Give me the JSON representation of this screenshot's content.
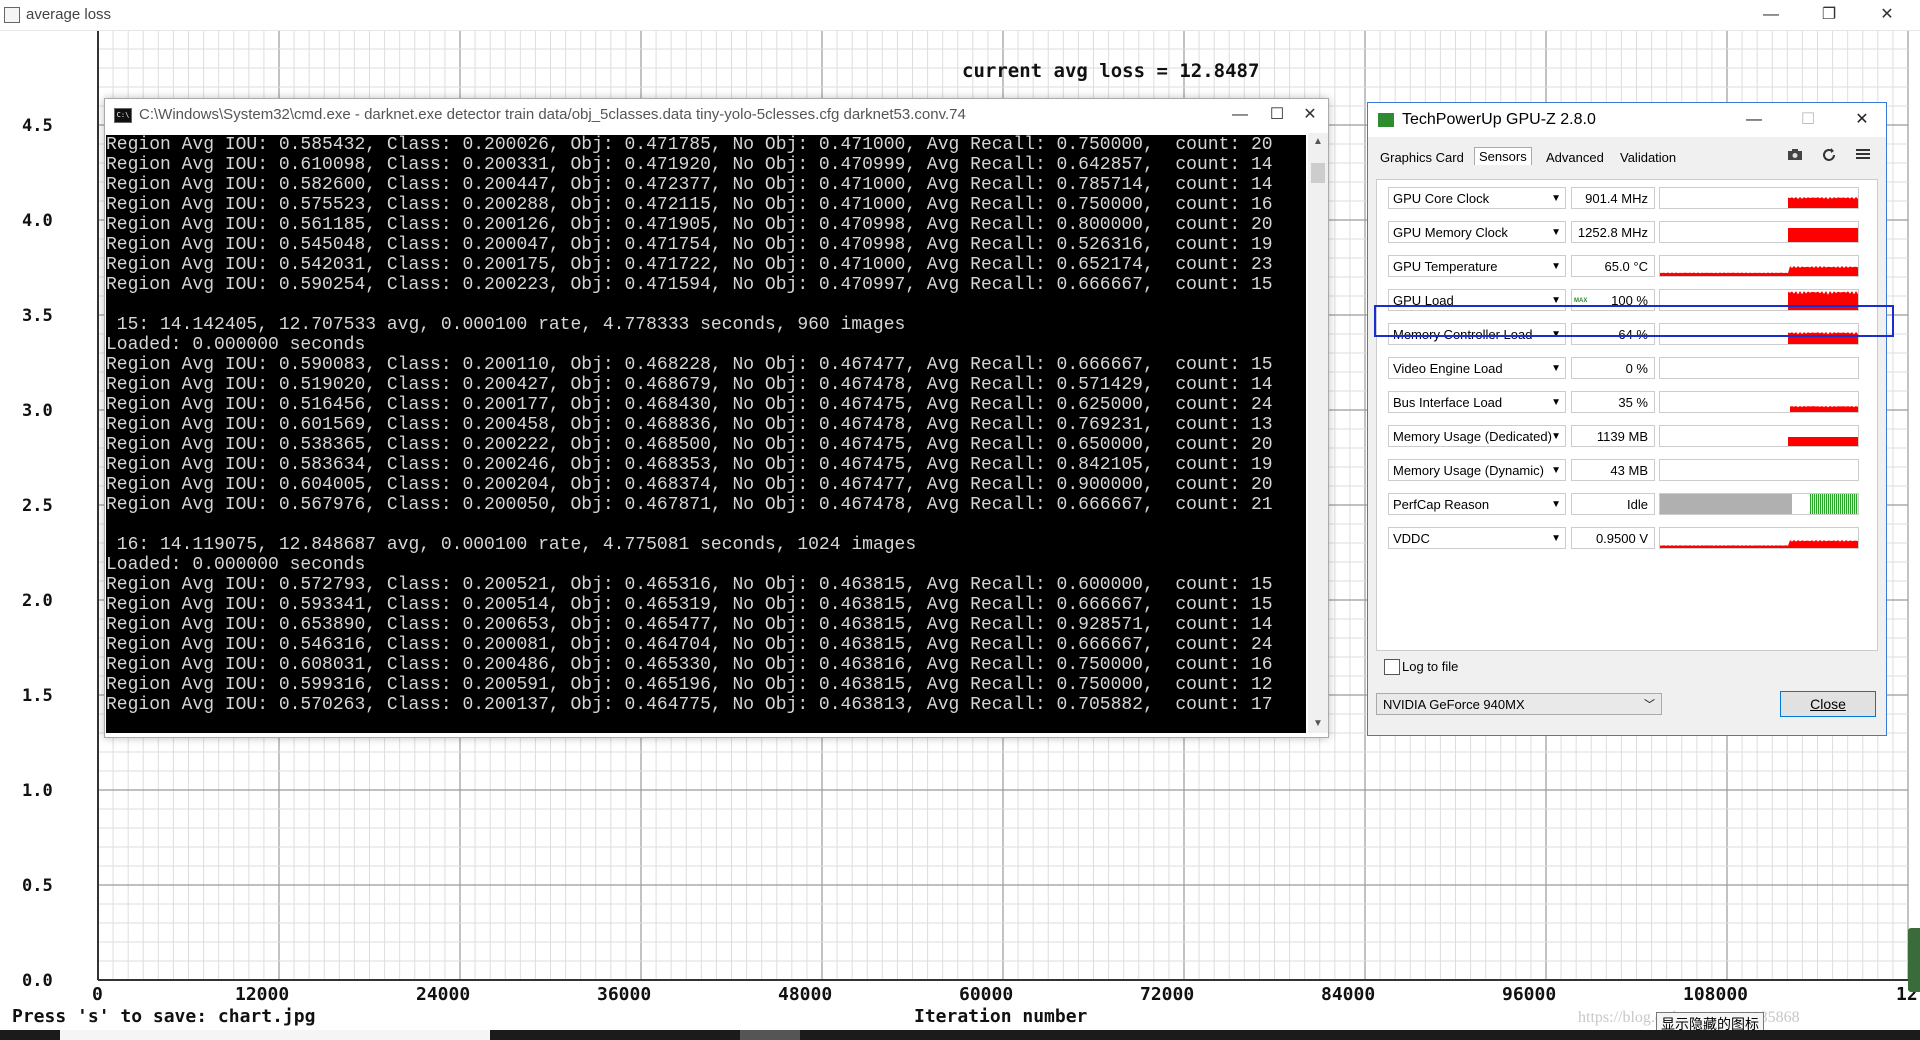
{
  "chart_window": {
    "title": "average loss",
    "title_icon": "chart-window-icon",
    "controls": {
      "minimize": "—",
      "maximize": "❐",
      "close": "✕"
    }
  },
  "chart_data": {
    "type": "line",
    "title": "current avg loss = 12.8487",
    "xlabel": "Iteration number",
    "ylabel": "",
    "x_ticks": [
      "0",
      "12000",
      "24000",
      "36000",
      "48000",
      "60000",
      "72000",
      "84000",
      "96000",
      "108000",
      "12"
    ],
    "y_ticks": [
      "0.0",
      "0.5",
      "1.0",
      "1.5",
      "2.0",
      "2.5",
      "3.0",
      "3.5",
      "4.0",
      "4.5"
    ],
    "xlim": [
      0,
      120000
    ],
    "ylim": [
      0,
      5
    ],
    "grid": true,
    "series": [],
    "footer": "Press 's' to save: chart.jpg"
  },
  "cmd_window": {
    "title": "C:\\Windows\\System32\\cmd.exe - darknet.exe  detector train data/obj_5classes.data tiny-yolo-5clesses.cfg darknet53.conv.74",
    "icon_text": "C:\\",
    "controls": {
      "minimize": "—",
      "maximize": "☐",
      "close": "✕"
    },
    "lines": [
      "Region Avg IOU: 0.585432, Class: 0.200026, Obj: 0.471785, No Obj: 0.471000, Avg Recall: 0.750000,  count: 20",
      "Region Avg IOU: 0.610098, Class: 0.200331, Obj: 0.471920, No Obj: 0.470999, Avg Recall: 0.642857,  count: 14",
      "Region Avg IOU: 0.582600, Class: 0.200447, Obj: 0.472377, No Obj: 0.471000, Avg Recall: 0.785714,  count: 14",
      "Region Avg IOU: 0.575523, Class: 0.200288, Obj: 0.472115, No Obj: 0.471000, Avg Recall: 0.750000,  count: 16",
      "Region Avg IOU: 0.561185, Class: 0.200126, Obj: 0.471905, No Obj: 0.470998, Avg Recall: 0.800000,  count: 20",
      "Region Avg IOU: 0.545048, Class: 0.200047, Obj: 0.471754, No Obj: 0.470998, Avg Recall: 0.526316,  count: 19",
      "Region Avg IOU: 0.542031, Class: 0.200175, Obj: 0.471722, No Obj: 0.471000, Avg Recall: 0.652174,  count: 23",
      "Region Avg IOU: 0.590254, Class: 0.200223, Obj: 0.471594, No Obj: 0.470997, Avg Recall: 0.666667,  count: 15",
      "",
      " 15: 14.142405, 12.707533 avg, 0.000100 rate, 4.778333 seconds, 960 images",
      "Loaded: 0.000000 seconds",
      "Region Avg IOU: 0.590083, Class: 0.200110, Obj: 0.468228, No Obj: 0.467477, Avg Recall: 0.666667,  count: 15",
      "Region Avg IOU: 0.519020, Class: 0.200427, Obj: 0.468679, No Obj: 0.467478, Avg Recall: 0.571429,  count: 14",
      "Region Avg IOU: 0.516456, Class: 0.200177, Obj: 0.468430, No Obj: 0.467475, Avg Recall: 0.625000,  count: 24",
      "Region Avg IOU: 0.601569, Class: 0.200458, Obj: 0.468836, No Obj: 0.467478, Avg Recall: 0.769231,  count: 13",
      "Region Avg IOU: 0.538365, Class: 0.200222, Obj: 0.468500, No Obj: 0.467475, Avg Recall: 0.650000,  count: 20",
      "Region Avg IOU: 0.583634, Class: 0.200246, Obj: 0.468353, No Obj: 0.467475, Avg Recall: 0.842105,  count: 19",
      "Region Avg IOU: 0.604005, Class: 0.200204, Obj: 0.468374, No Obj: 0.467477, Avg Recall: 0.900000,  count: 20",
      "Region Avg IOU: 0.567976, Class: 0.200050, Obj: 0.467871, No Obj: 0.467478, Avg Recall: 0.666667,  count: 21",
      "",
      " 16: 14.119075, 12.848687 avg, 0.000100 rate, 4.775081 seconds, 1024 images",
      "Loaded: 0.000000 seconds",
      "Region Avg IOU: 0.572793, Class: 0.200521, Obj: 0.465316, No Obj: 0.463815, Avg Recall: 0.600000,  count: 15",
      "Region Avg IOU: 0.593341, Class: 0.200514, Obj: 0.465319, No Obj: 0.463815, Avg Recall: 0.666667,  count: 15",
      "Region Avg IOU: 0.653890, Class: 0.200653, Obj: 0.465477, No Obj: 0.463815, Avg Recall: 0.928571,  count: 14",
      "Region Avg IOU: 0.546316, Class: 0.200081, Obj: 0.464704, No Obj: 0.463815, Avg Recall: 0.666667,  count: 24",
      "Region Avg IOU: 0.608031, Class: 0.200486, Obj: 0.465330, No Obj: 0.463816, Avg Recall: 0.750000,  count: 16",
      "Region Avg IOU: 0.599316, Class: 0.200591, Obj: 0.465196, No Obj: 0.463815, Avg Recall: 0.750000,  count: 12",
      "Region Avg IOU: 0.570263, Class: 0.200137, Obj: 0.464775, No Obj: 0.463813, Avg Recall: 0.705882,  count: 17"
    ]
  },
  "gpuz": {
    "title": "TechPowerUp GPU-Z 2.8.0",
    "controls": {
      "minimize": "—",
      "maximize": "☐",
      "close": "✕"
    },
    "tabs": [
      {
        "label": "Graphics Card",
        "active": false
      },
      {
        "label": "Sensors",
        "active": true
      },
      {
        "label": "Advanced",
        "active": false
      },
      {
        "label": "Validation",
        "active": false
      }
    ],
    "tool_icons": [
      "camera-icon",
      "refresh-icon",
      "menu-icon"
    ],
    "sensors": [
      {
        "name": "GPU Core Clock",
        "value": "901.4 MHz",
        "graph": "red-spiky",
        "level": 0.55
      },
      {
        "name": "GPU Memory Clock",
        "value": "1252.8 MHz",
        "graph": "red-block",
        "level": 0.7
      },
      {
        "name": "GPU Temperature",
        "value": "65.0 °C",
        "graph": "red-ramp",
        "level": 0.5
      },
      {
        "name": "GPU Load",
        "value": "100 %",
        "graph": "red-spiky",
        "level": 0.95,
        "max_badge": "MAX"
      },
      {
        "name": "Memory Controller Load",
        "value": "64 %",
        "graph": "red-spiky",
        "level": 0.6
      },
      {
        "name": "Video Engine Load",
        "value": "0 %",
        "graph": "none",
        "level": 0
      },
      {
        "name": "Bus Interface Load",
        "value": "35 %",
        "graph": "red-low",
        "level": 0.3
      },
      {
        "name": "Memory Usage (Dedicated)",
        "value": "1139 MB",
        "graph": "red-block",
        "level": 0.45
      },
      {
        "name": "Memory Usage (Dynamic)",
        "value": "43 MB",
        "graph": "none",
        "level": 0
      },
      {
        "name": "PerfCap Reason",
        "value": "Idle",
        "graph": "gray-green",
        "level": 1
      },
      {
        "name": "VDDC",
        "value": "0.9500 V",
        "graph": "red-ramp",
        "level": 0.4
      }
    ],
    "log_to_file": "Log to file",
    "gpu_name": "NVIDIA GeForce 940MX",
    "close_label": "Close"
  },
  "overlay": {
    "watermark": "https://blog.csdn.net/qq_41185868",
    "tooltip": "显示隐藏的图标"
  },
  "colors": {
    "graph_red": "#ff0000",
    "graph_green": "#2aa52a",
    "graph_gray": "#b0b0b0",
    "highlight": "#1a2ecf"
  }
}
